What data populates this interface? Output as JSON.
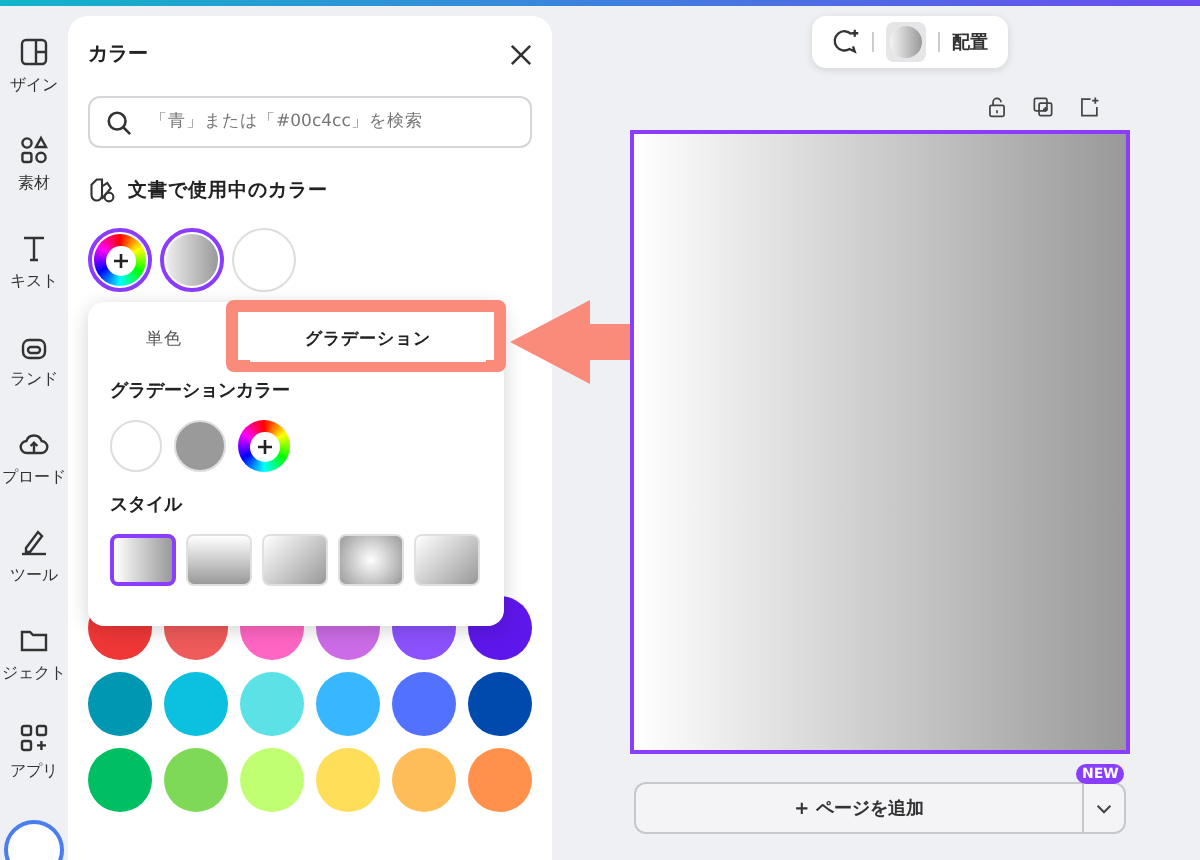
{
  "sidebar": {
    "items": [
      {
        "label": "ザイン"
      },
      {
        "label": "素材"
      },
      {
        "label": "キスト"
      },
      {
        "label": "ランド"
      },
      {
        "label": "プロード"
      },
      {
        "label": "ツール"
      },
      {
        "label": "ジェクト"
      },
      {
        "label": "アプリ"
      }
    ]
  },
  "color_panel": {
    "title": "カラー",
    "search": {
      "placeholder": "「青」または「#00c4cc」を検索"
    },
    "document_colors_heading": "文書で使用中のカラー",
    "document_colors": [
      {
        "kind": "add",
        "selected": true
      },
      {
        "kind": "gradient",
        "selected": true
      },
      {
        "kind": "solid",
        "color": "#ffffff",
        "selected": false
      }
    ],
    "palette": [
      {
        "color": "#f03737"
      },
      {
        "color": "#ef5a5a"
      },
      {
        "color": "#ff66c4"
      },
      {
        "color": "#cb6ce6"
      },
      {
        "color": "#8c52ff"
      },
      {
        "color": "#5e17eb"
      },
      {
        "color": "#0097b2"
      },
      {
        "color": "#0cc0df"
      },
      {
        "color": "#5ce1e6"
      },
      {
        "color": "#38b6ff"
      },
      {
        "color": "#5271ff"
      },
      {
        "color": "#004aad"
      },
      {
        "color": "#00bf63"
      },
      {
        "color": "#7ed957"
      },
      {
        "color": "#c1ff72"
      },
      {
        "color": "#ffde59"
      },
      {
        "color": "#ffbd59"
      },
      {
        "color": "#ff914d"
      }
    ]
  },
  "gradient_popup": {
    "tabs": [
      {
        "label": "単色",
        "selected": false
      },
      {
        "label": "グラデーション",
        "selected": true
      }
    ],
    "gradient_colors_heading": "グラデーションカラー",
    "gradient_colors": [
      {
        "kind": "solid",
        "color": "#ffffff"
      },
      {
        "kind": "solid",
        "color": "#9a9a9a"
      },
      {
        "kind": "add"
      }
    ],
    "style_heading": "スタイル",
    "styles": [
      {
        "kind": "linear",
        "selected": true
      },
      {
        "kind": "vertical",
        "selected": false
      },
      {
        "kind": "diagonal",
        "selected": false
      },
      {
        "kind": "radial",
        "selected": false
      },
      {
        "kind": "diagonal-reverse",
        "selected": false
      }
    ]
  },
  "toolbar": {
    "label": "配置"
  },
  "add_page": {
    "label": "+ ページを追加",
    "badge": "NEW"
  }
}
